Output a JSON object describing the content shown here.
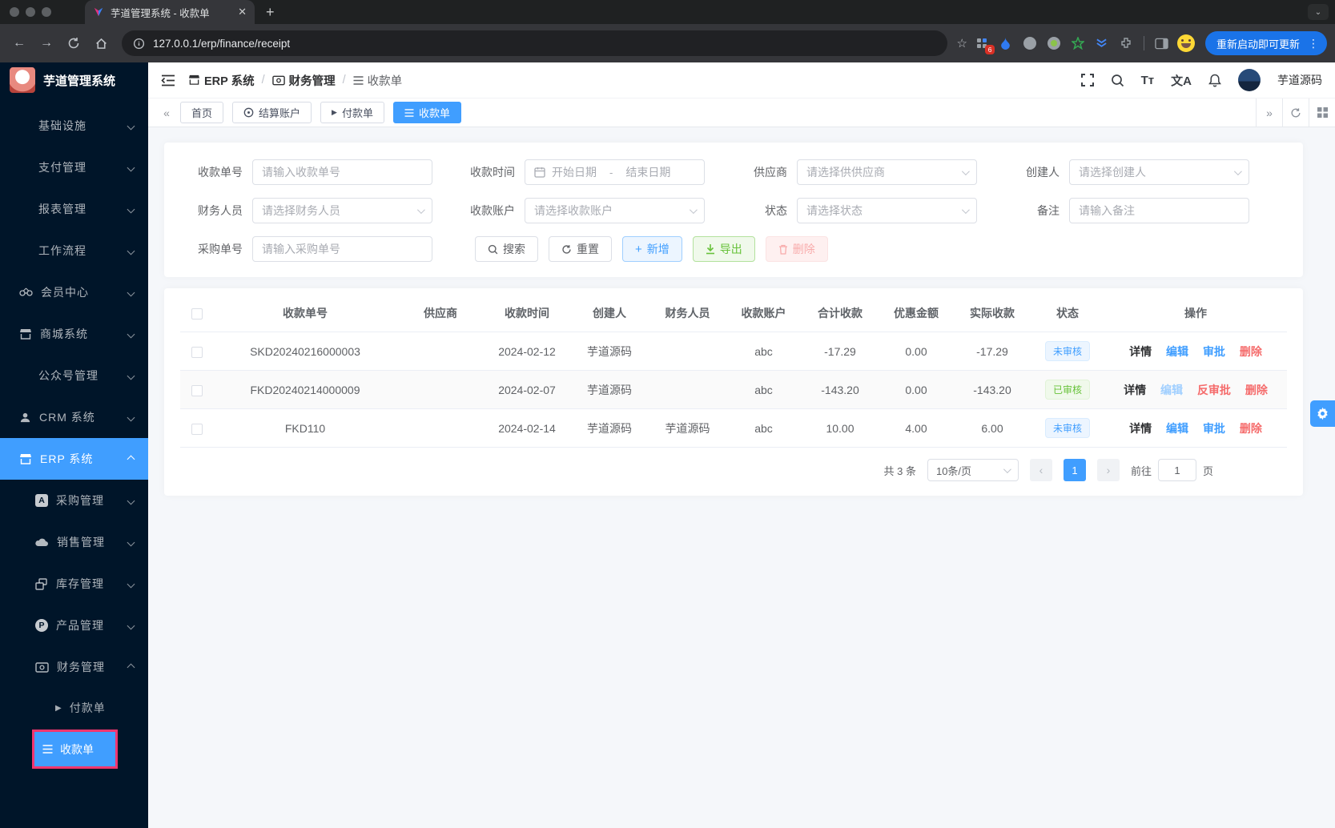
{
  "browser": {
    "tab_title": "芋道管理系统 - 收款单",
    "url": "127.0.0.1/erp/finance/receipt",
    "extension_badge": "6",
    "update_button": "重新启动即可更新"
  },
  "sidebar": {
    "logo_title": "芋道管理系统",
    "items": [
      {
        "label": "基础设施"
      },
      {
        "label": "支付管理"
      },
      {
        "label": "报表管理"
      },
      {
        "label": "工作流程"
      },
      {
        "label": "会员中心"
      },
      {
        "label": "商城系统"
      },
      {
        "label": "公众号管理"
      },
      {
        "label": "CRM 系统"
      },
      {
        "label": "ERP 系统"
      },
      {
        "label": "采购管理"
      },
      {
        "label": "销售管理"
      },
      {
        "label": "库存管理"
      },
      {
        "label": "产品管理"
      },
      {
        "label": "财务管理"
      },
      {
        "label": "付款单"
      },
      {
        "label": "收款单"
      }
    ]
  },
  "header": {
    "breadcrumb": [
      {
        "label": "ERP 系统"
      },
      {
        "label": "财务管理"
      },
      {
        "label": "收款单"
      }
    ],
    "username": "芋道源码",
    "font_tool": "Tт",
    "lang_tool": "文A"
  },
  "tags": {
    "items": [
      {
        "label": "首页"
      },
      {
        "label": "结算账户"
      },
      {
        "label": "付款单"
      },
      {
        "label": "收款单"
      }
    ]
  },
  "filters": {
    "receipt_no": {
      "label": "收款单号",
      "placeholder": "请输入收款单号"
    },
    "receipt_time": {
      "label": "收款时间",
      "start_placeholder": "开始日期",
      "separator": "-",
      "end_placeholder": "结束日期"
    },
    "supplier": {
      "label": "供应商",
      "placeholder": "请选择供供应商"
    },
    "creator": {
      "label": "创建人",
      "placeholder": "请选择创建人"
    },
    "finance_staff": {
      "label": "财务人员",
      "placeholder": "请选择财务人员"
    },
    "receipt_account": {
      "label": "收款账户",
      "placeholder": "请选择收款账户"
    },
    "status": {
      "label": "状态",
      "placeholder": "请选择状态"
    },
    "remark": {
      "label": "备注",
      "placeholder": "请输入备注"
    },
    "purchase_no": {
      "label": "采购单号",
      "placeholder": "请输入采购单号"
    }
  },
  "toolbar": {
    "search": "搜索",
    "reset": "重置",
    "add": "新增",
    "export": "导出",
    "delete": "删除"
  },
  "table": {
    "headers": [
      "收款单号",
      "供应商",
      "收款时间",
      "创建人",
      "财务人员",
      "收款账户",
      "合计收款",
      "优惠金额",
      "实际收款",
      "状态",
      "操作"
    ],
    "rows": [
      {
        "receipt_no": "SKD20240216000003",
        "supplier": "",
        "receipt_time": "2024-02-12",
        "creator": "芋道源码",
        "finance_staff": "",
        "account": "abc",
        "total": "-17.29",
        "discount": "0.00",
        "actual": "-17.29",
        "status": "未审核",
        "actions": {
          "detail": "详情",
          "edit": "编辑",
          "approve": "审批",
          "delete": "删除"
        }
      },
      {
        "receipt_no": "FKD20240214000009",
        "supplier": "",
        "receipt_time": "2024-02-07",
        "creator": "芋道源码",
        "finance_staff": "",
        "account": "abc",
        "total": "-143.20",
        "discount": "0.00",
        "actual": "-143.20",
        "status": "已审核",
        "actions": {
          "detail": "详情",
          "edit": "编辑",
          "approve": "反审批",
          "delete": "删除"
        }
      },
      {
        "receipt_no": "FKD110",
        "supplier": "",
        "receipt_time": "2024-02-14",
        "creator": "芋道源码",
        "finance_staff": "芋道源码",
        "account": "abc",
        "total": "10.00",
        "discount": "4.00",
        "actual": "6.00",
        "status": "未审核",
        "actions": {
          "detail": "详情",
          "edit": "编辑",
          "approve": "审批",
          "delete": "删除"
        }
      }
    ]
  },
  "pagination": {
    "total": "共 3 条",
    "page_size": "10条/页",
    "current_page": "1",
    "goto_label": "前往",
    "goto_value": "1",
    "page_unit": "页"
  },
  "colors": {
    "primary": "#409eff",
    "success": "#67c23a",
    "danger": "#f56c6c",
    "sidebar_bg": "#001529",
    "annotation": "#f1366f"
  }
}
